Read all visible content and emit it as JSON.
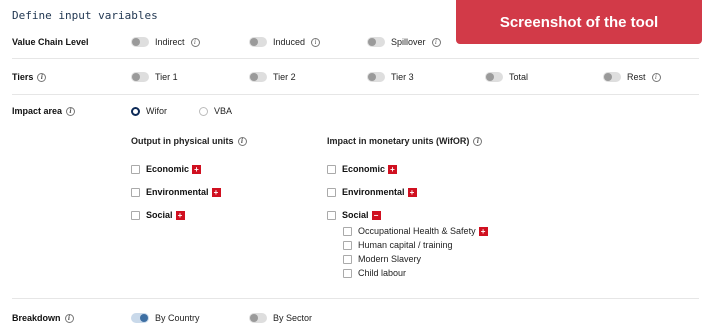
{
  "header": {
    "title": "Define input variables",
    "banner": "Screenshot of the tool"
  },
  "value_chain": {
    "label": "Value Chain Level",
    "options": [
      "Indirect",
      "Induced",
      "Spillover"
    ]
  },
  "tiers": {
    "label": "Tiers",
    "options": [
      "Tier 1",
      "Tier 2",
      "Tier 3",
      "Total",
      "Rest"
    ]
  },
  "impact_area": {
    "label": "Impact area",
    "options": [
      "Wifor",
      "VBA"
    ],
    "selected": "Wifor"
  },
  "physical": {
    "heading": "Output in physical units",
    "items": [
      "Economic",
      "Environmental",
      "Social"
    ]
  },
  "monetary": {
    "heading": "Impact in monetary units (WifOR)",
    "items": [
      "Economic",
      "Environmental",
      "Social"
    ],
    "social_sub": [
      "Occupational Health & Safety",
      "Human capital / training",
      "Modern Slavery",
      "Child labour"
    ]
  },
  "breakdown": {
    "label": "Breakdown",
    "options": [
      "By Country",
      "By Sector"
    ],
    "selected": "By Country"
  },
  "icons": {
    "info": "info-circle-icon",
    "expand": "plus-square-icon",
    "collapse": "minus-square-icon"
  },
  "glyphs": {
    "info": "i",
    "plus": "+",
    "minus": "−"
  },
  "colors": {
    "banner": "#d23a48",
    "accent": "#0d2a57",
    "expand_badge": "#d01020"
  }
}
